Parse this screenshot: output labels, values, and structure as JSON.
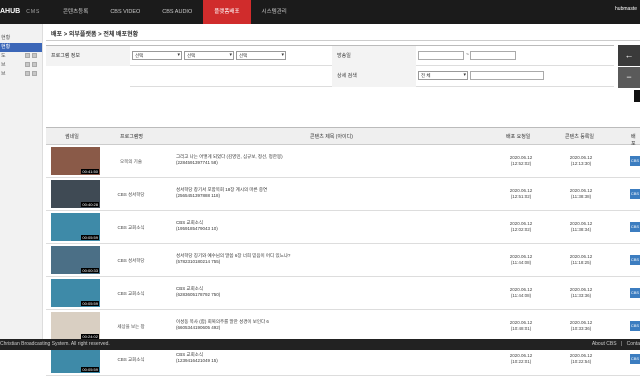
{
  "topbar": {
    "logo": "AHUB",
    "logo_sub": "CMS",
    "user": "hubmaste",
    "nav": [
      "콘텐츠등록",
      "CBS VIDEO",
      "CBS AUDIO",
      "플랫폼배포",
      "시스템관리"
    ]
  },
  "sidebar": {
    "items": [
      "현황",
      "도",
      "브",
      "브"
    ]
  },
  "breadcrumb": "배포 > 외부플랫폼 > 전체 배포현황",
  "filter": {
    "program_label": "프로그램 정보",
    "select1": "선택",
    "select2": "선택",
    "select3": "선택",
    "airdate_label": "방송일",
    "date_sep": "~",
    "detail_label": "상세 검색",
    "detail_select": "전 체",
    "search_btn": "←",
    "reset_btn": "−"
  },
  "table": {
    "headers": [
      "썸네일",
      "프로그램명",
      "콘텐츠 제목 (아이디)",
      "배포 요청일",
      "콘텐츠 등록일",
      "배포"
    ],
    "rows": [
      {
        "duration": "00:41:50",
        "program": "오목의 기술",
        "title": "그리고 나는 어떻게 되었다 (김영민, 심규보, 정선, 정한봉)",
        "id": "(2284591397741 58)",
        "req_date": "2020.06.12",
        "req_time": "(12:52:02)",
        "reg_date": "2020.06.12",
        "reg_time": "(12:13:30)",
        "btn": "CBS",
        "thumb": "#8a5a48"
      },
      {
        "duration": "00:40:28",
        "program": "CBS 성서학당",
        "title": "성서학당 창기서 포함목회 18장 계시의 마른 중연",
        "id": "(2565451397888 118)",
        "req_date": "2020.06.12",
        "req_time": "(12:51:02)",
        "reg_date": "2020.06.12",
        "reg_time": "(11:38:38)",
        "btn": "CBS",
        "thumb": "#3f4a54"
      },
      {
        "duration": "00:05:59",
        "program": "CBS 교회소식",
        "title": "CBS 교회소식",
        "id": "(1959185479043 10)",
        "req_date": "2020.06.12",
        "req_time": "(12:02:02)",
        "reg_date": "2020.06.12",
        "reg_time": "(11:38:34)",
        "btn": "CBS",
        "thumb": "#3e8aa8"
      },
      {
        "duration": "00:00:33",
        "program": "CBS 성서학당",
        "title": "성서학당 징기와 예수님의 말씀 6장 너희 믿음이 어디 있느냐?",
        "id": "(5782310180214 755)",
        "req_date": "2020.06.12",
        "req_time": "(11:44:08)",
        "reg_date": "2020.06.12",
        "reg_time": "(11:18:25)",
        "btn": "CBS",
        "thumb": "#4b6f86"
      },
      {
        "duration": "00:05:59",
        "program": "CBS 교회소식",
        "title": "CBS 교회소식",
        "id": "(6283605178792 750)",
        "req_date": "2020.06.12",
        "req_time": "(11:44:08)",
        "reg_date": "2020.06.12",
        "reg_time": "(11:33:36)",
        "btn": "CBS",
        "thumb": "#3e8aa8"
      },
      {
        "duration": "00:24:02",
        "program": "세상을 보는 창",
        "title": "이성동 목사 (합) 회복의주를 말한 성경이 보인다 6",
        "id": "(6605344190605 492)",
        "req_date": "2020.06.12",
        "req_time": "(10:48:01)",
        "reg_date": "2020.06.12",
        "reg_time": "(10:33:36)",
        "btn": "CBS",
        "thumb": "#d9cfc2"
      },
      {
        "duration": "00:05:59",
        "program": "CBS 교회소식",
        "title": "CBS 교회소식",
        "id": "(1239416421049 15)",
        "req_date": "2020.06.12",
        "req_time": "(10:22:01)",
        "reg_date": "2020.06.12",
        "reg_time": "(10:22:54)",
        "btn": "CBS",
        "thumb": "#3e8aa8"
      }
    ]
  },
  "footer": {
    "copyright": "Christian Broadcasting System. All right reserved.",
    "about": "About CBS",
    "contact": "Conta"
  }
}
